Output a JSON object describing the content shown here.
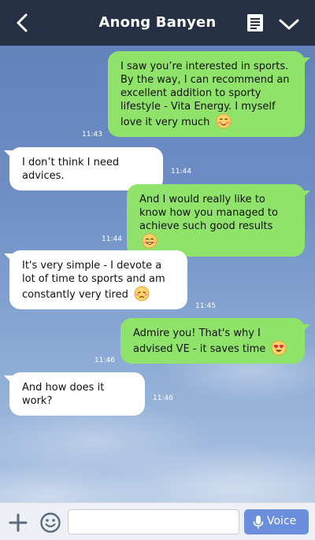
{
  "header": {
    "title": "Anong Banyen",
    "back_icon": "chevron-left-icon",
    "notes_icon": "notes-icon",
    "menu_icon": "chevron-down-icon"
  },
  "messages": [
    {
      "side": "sent",
      "text": "I saw you’re interested in sports. By the way, I can recommend an excellent addition to sporty lifestyle - Vita Energy. I myself love it very much",
      "emoji": "blushing-face",
      "time": "11:43"
    },
    {
      "side": "received",
      "text": "I don’t think I need advices.",
      "time": "11:44"
    },
    {
      "side": "sent",
      "text": "And I would really like to know how you managed to achieve such good results",
      "emoji": "smiling-face",
      "time": "11:44"
    },
    {
      "side": "received",
      "text": "It's very simple - I devote a lot of time to sports and am constantly very tired",
      "emoji": "tired-face",
      "time": "11:45"
    },
    {
      "side": "sent",
      "text": "Admire you! That's why I advised VE - it saves time",
      "emoji": "heart-eyes-face",
      "time": "11:46"
    },
    {
      "side": "received",
      "text": "And how does it work?",
      "time": "11:46"
    }
  ],
  "input_bar": {
    "voice_label": "Voice",
    "placeholder": ""
  },
  "colors": {
    "header": "#263044",
    "sent_bubble": "#8fe36a",
    "received_bubble": "#ffffff",
    "voice_button": "#6b8fdd"
  }
}
